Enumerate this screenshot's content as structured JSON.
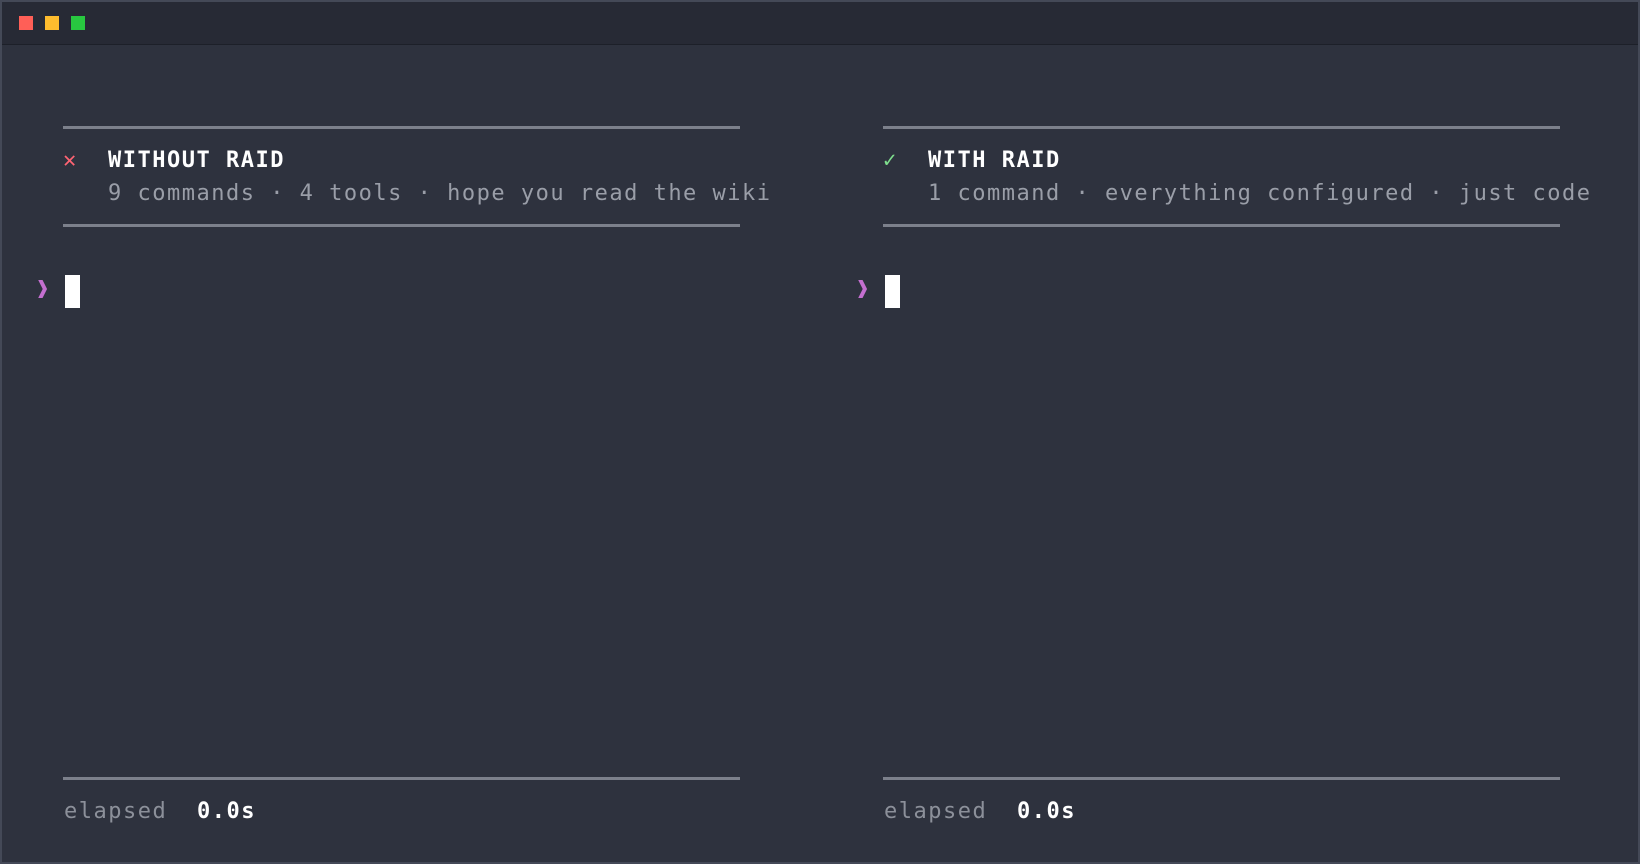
{
  "window": {
    "controls": [
      "close-icon",
      "minimize-icon",
      "maximize-icon"
    ],
    "colors": {
      "close": "#ff5f57",
      "minimize": "#febc2e",
      "maximize": "#28c840"
    }
  },
  "left_pane": {
    "status_icon": "✕",
    "status_icon_name": "x-icon",
    "title": "WITHOUT RAID",
    "subtitle": "9 commands · 4 tools · hope you read the wiki",
    "prompt_glyph": "❱",
    "elapsed_label": "elapsed",
    "elapsed_value": "0.0s"
  },
  "right_pane": {
    "status_icon": "✓",
    "status_icon_name": "check-icon",
    "title": "WITH RAID",
    "subtitle": "1 command · everything configured · just code",
    "prompt_glyph": "❱",
    "elapsed_label": "elapsed",
    "elapsed_value": "0.0s"
  },
  "colors": {
    "background": "#2e323e",
    "titlebar": "#272a35",
    "bad": "#ff6473",
    "good": "#7fe08e",
    "prompt": "#c46fd0",
    "muted_text": "#9a9ea8"
  }
}
